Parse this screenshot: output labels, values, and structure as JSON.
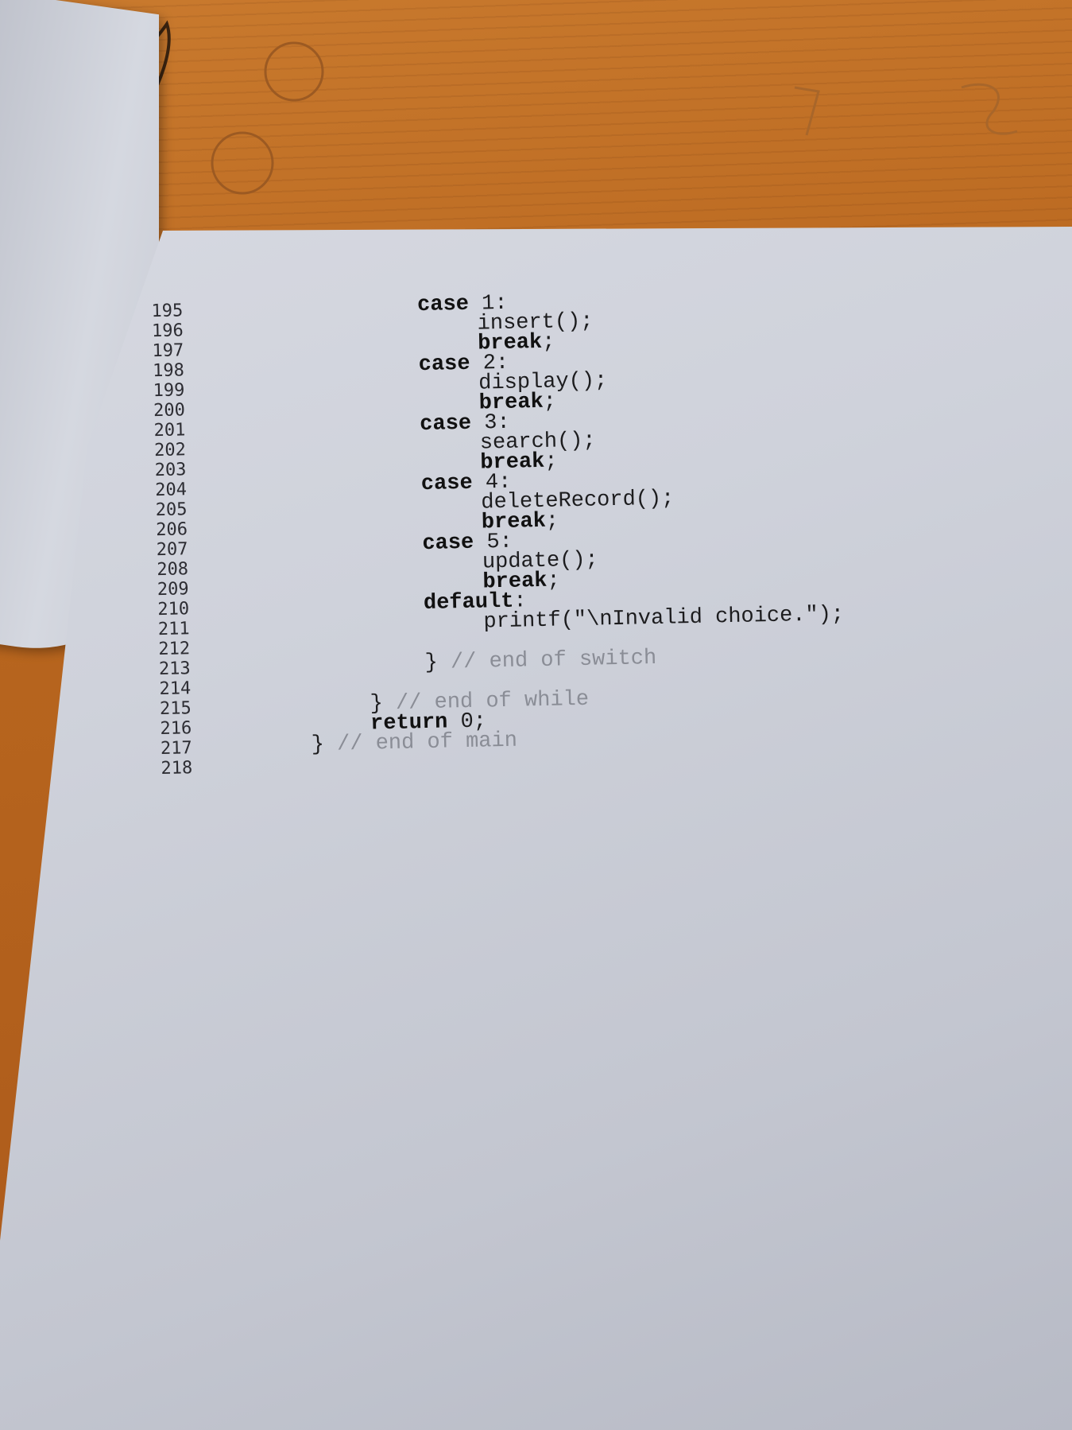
{
  "lines": [
    {
      "num": "195",
      "parts": [
        {
          "t": "case",
          "k": "kw"
        },
        {
          "t": " 1:",
          "k": ""
        }
      ],
      "indent": 4
    },
    {
      "num": "196",
      "parts": [
        {
          "t": "insert();",
          "k": ""
        }
      ],
      "indent": 5
    },
    {
      "num": "197",
      "parts": [
        {
          "t": "break",
          "k": "kw"
        },
        {
          "t": ";",
          "k": ""
        }
      ],
      "indent": 5
    },
    {
      "num": "198",
      "parts": [
        {
          "t": "case",
          "k": "kw"
        },
        {
          "t": " 2:",
          "k": ""
        }
      ],
      "indent": 4
    },
    {
      "num": "199",
      "parts": [
        {
          "t": "display();",
          "k": ""
        }
      ],
      "indent": 5
    },
    {
      "num": "200",
      "parts": [
        {
          "t": "break",
          "k": "kw"
        },
        {
          "t": ";",
          "k": ""
        }
      ],
      "indent": 5
    },
    {
      "num": "201",
      "parts": [
        {
          "t": "case",
          "k": "kw"
        },
        {
          "t": " 3:",
          "k": ""
        }
      ],
      "indent": 4
    },
    {
      "num": "202",
      "parts": [
        {
          "t": "search();",
          "k": ""
        }
      ],
      "indent": 5
    },
    {
      "num": "203",
      "parts": [
        {
          "t": "break",
          "k": "kw"
        },
        {
          "t": ";",
          "k": ""
        }
      ],
      "indent": 5
    },
    {
      "num": "204",
      "parts": [
        {
          "t": "case",
          "k": "kw"
        },
        {
          "t": " 4:",
          "k": ""
        }
      ],
      "indent": 4
    },
    {
      "num": "205",
      "parts": [
        {
          "t": "deleteRecord();",
          "k": ""
        }
      ],
      "indent": 5
    },
    {
      "num": "206",
      "parts": [
        {
          "t": "break",
          "k": "kw"
        },
        {
          "t": ";",
          "k": ""
        }
      ],
      "indent": 5
    },
    {
      "num": "207",
      "parts": [
        {
          "t": "case",
          "k": "kw"
        },
        {
          "t": " 5:",
          "k": ""
        }
      ],
      "indent": 4
    },
    {
      "num": "208",
      "parts": [
        {
          "t": "update();",
          "k": ""
        }
      ],
      "indent": 5
    },
    {
      "num": "209",
      "parts": [
        {
          "t": "break",
          "k": "kw"
        },
        {
          "t": ";",
          "k": ""
        }
      ],
      "indent": 5
    },
    {
      "num": "210",
      "parts": [
        {
          "t": "default",
          "k": "kw"
        },
        {
          "t": ":",
          "k": ""
        }
      ],
      "indent": 4
    },
    {
      "num": "211",
      "parts": [
        {
          "t": "printf(\"\\nInvalid choice.\");",
          "k": ""
        }
      ],
      "indent": 5
    },
    {
      "num": "212",
      "parts": [],
      "indent": 0
    },
    {
      "num": "213",
      "parts": [
        {
          "t": "} ",
          "k": ""
        },
        {
          "t": "// end of switch",
          "k": "comment"
        }
      ],
      "indent": 4
    },
    {
      "num": "214",
      "parts": [],
      "indent": 0
    },
    {
      "num": "215",
      "parts": [
        {
          "t": "} ",
          "k": ""
        },
        {
          "t": "// end of while",
          "k": "comment"
        }
      ],
      "indent": 3
    },
    {
      "num": "216",
      "parts": [
        {
          "t": "return",
          "k": "kw"
        },
        {
          "t": " 0;",
          "k": ""
        }
      ],
      "indent": 3
    },
    {
      "num": "217",
      "parts": [
        {
          "t": "} ",
          "k": ""
        },
        {
          "t": "// end of main",
          "k": "comment"
        }
      ],
      "indent": 2
    },
    {
      "num": "218",
      "parts": [],
      "indent": 0
    }
  ]
}
